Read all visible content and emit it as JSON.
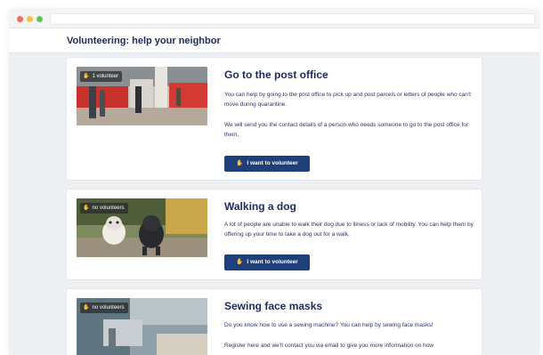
{
  "window": {
    "controls": [
      "close",
      "minimize",
      "maximize"
    ],
    "colors": {
      "close": "#f26b5b",
      "minimize": "#f4bf4f",
      "maximize": "#61c554"
    }
  },
  "header": {
    "title": "Volunteering: help your neighbor"
  },
  "accent": "#1f3f7a",
  "opportunities": [
    {
      "badge": "1 volunteer",
      "badge_icon": "hand-icon",
      "title": "Go to the post office",
      "paragraphs": [
        "You can help by going to the post office to pick up and post parcels or letters of people who can't move during quarantine.",
        "We will send you the contact details of a person who needs someone to go to the post office for them."
      ],
      "button": "I want to volunteer"
    },
    {
      "badge": "no volunteers",
      "badge_icon": "hand-icon",
      "title": "Walking a dog",
      "paragraphs": [
        "A lot of people are unable to walk their dog due to illness or lack of mobility. You can help them by offering up your time to take a dog out for a walk."
      ],
      "button": "I want to volunteer"
    },
    {
      "badge": "no volunteers",
      "badge_icon": "hand-icon",
      "title": "Sewing face masks",
      "paragraphs": [
        "Do you know how to use a sewing machine? You can help by sewing face masks!",
        "Register here and we'll contact you via email to give you more information on how"
      ]
    }
  ]
}
